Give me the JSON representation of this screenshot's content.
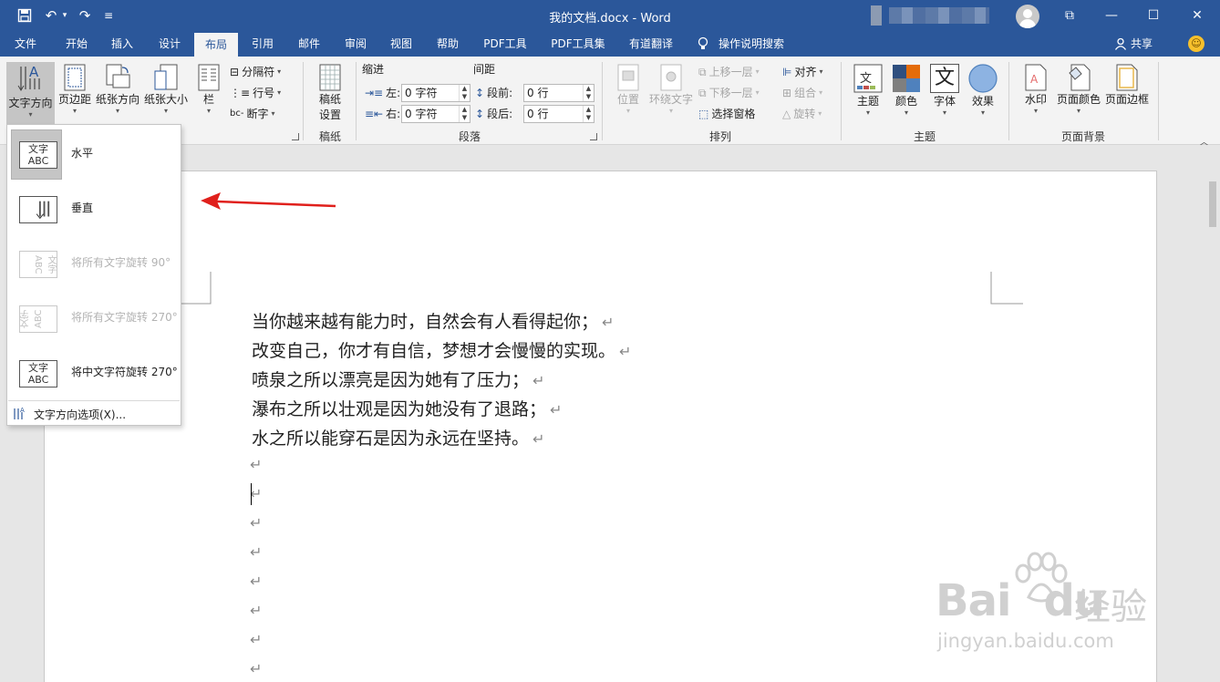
{
  "window": {
    "title": "我的文档.docx  -  Word",
    "controls": {
      "restore_ribbon": "⧉",
      "minimize": "—",
      "maximize": "☐",
      "close": "✕"
    }
  },
  "quick_access": {
    "save": "💾",
    "undo": "↶",
    "undo_caret": "▾",
    "redo": "↷",
    "customize": "≡"
  },
  "tabs": [
    {
      "label": "文件"
    },
    {
      "label": "开始"
    },
    {
      "label": "插入"
    },
    {
      "label": "设计"
    },
    {
      "label": "布局",
      "active": true
    },
    {
      "label": "引用"
    },
    {
      "label": "邮件"
    },
    {
      "label": "审阅"
    },
    {
      "label": "视图"
    },
    {
      "label": "帮助"
    },
    {
      "label": "PDF工具"
    },
    {
      "label": "PDF工具集"
    },
    {
      "label": "有道翻译"
    }
  ],
  "tellme": {
    "label": "操作说明搜索",
    "icon": "lightbulb-icon"
  },
  "share": {
    "label": "共享"
  },
  "ribbon": {
    "page_setup": {
      "text_direction": "文字方向",
      "margins": "页边距",
      "orientation": "纸张方向",
      "size": "纸张大小",
      "columns": "栏",
      "breaks": "分隔符",
      "line_numbers": "行号",
      "hyphenation": "断字"
    },
    "manuscript": {
      "button": [
        "稿纸",
        "设置"
      ],
      "label": "稿纸"
    },
    "paragraph": {
      "indent_header": "缩进",
      "spacing_header": "间距",
      "left_label": "左:",
      "left_value": "0 字符",
      "right_label": "右:",
      "right_value": "0 字符",
      "before_label": "段前:",
      "before_value": "0 行",
      "after_label": "段后:",
      "after_value": "0 行",
      "label": "段落"
    },
    "arrange": {
      "position": "位置",
      "wrap_text": "环绕文字",
      "bring_forward": "上移一层",
      "send_backward": "下移一层",
      "selection_pane": "选择窗格",
      "align": "对齐",
      "group": "组合",
      "rotate": "旋转",
      "label": "排列"
    },
    "themes": {
      "themes": "主题",
      "colors": "颜色",
      "fonts": "字体",
      "effects": "效果",
      "label": "主题",
      "font_glyph": "文",
      "colors_swatch": [
        "#2f4f7f",
        "#e46c0a",
        "#7f7f7f",
        "#4f81bd"
      ],
      "effects_color": "#8db3e2"
    },
    "page_background": {
      "watermark": "水印",
      "page_color": "页面颜色",
      "page_borders": "页面边框",
      "label": "页面背景"
    }
  },
  "dropdown": {
    "options": [
      {
        "label": "水平",
        "thumb": "文字\nABC",
        "selected": true,
        "enabled": true
      },
      {
        "label": "垂直",
        "thumb": "",
        "selected": false,
        "enabled": true
      },
      {
        "label": "将所有文字旋转 90°",
        "thumb": "文字 ABC",
        "selected": false,
        "enabled": false
      },
      {
        "label": "将所有文字旋转 270°",
        "thumb": "文字 ABC",
        "selected": false,
        "enabled": false
      },
      {
        "label": "将中文字符旋转 270°",
        "thumb": "文字\nABC",
        "selected": false,
        "enabled": true
      }
    ],
    "footer": "文字方向选项(X)..."
  },
  "document": {
    "lines": [
      "当你越来越有能力时，自然会有人看得起你；",
      "改变自己，你才有自信，梦想才会慢慢的实现。",
      "喷泉之所以漂亮是因为她有了压力；",
      "瀑布之所以壮观是因为她没有了退路；",
      "水之所以能穿石是因为永远在坚持。"
    ],
    "paragraph_mark": "↵"
  },
  "watermark": {
    "brand": "Bai",
    "brand2": "du",
    "cn": "经验",
    "url": "jingyan.baidu.com"
  },
  "colors": {
    "title_blue": "#2b579a",
    "ribbon_bg": "#f3f3f3",
    "arrow_red": "#e0201c"
  }
}
